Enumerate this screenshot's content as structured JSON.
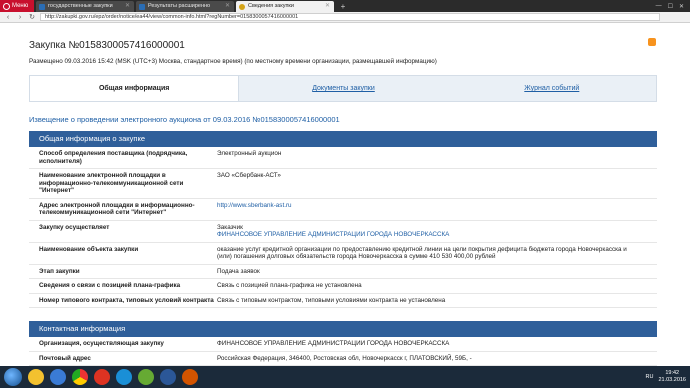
{
  "browser": {
    "menu_label": "Меню",
    "tabs": [
      {
        "label": "государственные закупки",
        "active": false
      },
      {
        "label": "Результаты расширенно",
        "active": false
      },
      {
        "label": "Сведения закупки",
        "active": true
      }
    ],
    "url": "http://zakupki.gov.ru/epz/order/notice/ea44/view/common-info.html?regNumber=0158300057416000001"
  },
  "page": {
    "title": "Закупка №0158300057416000001",
    "posted": "Размещено 09.03.2016 15:42 (MSK (UTC+3) Москва, стандартное время) (по местному времени организации, размещавшей информацию)",
    "tabs": [
      "Общая информация",
      "Документы закупки",
      "Журнал событий"
    ],
    "notice_title": "Извещение о проведении электронного аукциона от 09.03.2016 №0158300057416000001",
    "section_general": "Общая информация о закупке",
    "rows": [
      {
        "k": "Способ определения поставщика (подрядчика, исполнителя)",
        "v": "Электронный аукцион"
      },
      {
        "k": "Наименование электронной площадки в информационно-телекоммуникационной сети \"Интернет\"",
        "v": "ЗАО «Сбербанк-АСТ»"
      },
      {
        "k": "Адрес электронной площадки в информационно-телекоммуникационной сети \"Интернет\"",
        "v": "http://www.sberbank-ast.ru",
        "link": true
      },
      {
        "k": "Закупку осуществляет",
        "v": "Заказчик",
        "v2": "ФИНАНСОВОЕ УПРАВЛЕНИЕ АДМИНИСТРАЦИИ ГОРОДА НОВОЧЕРКАССКА"
      },
      {
        "k": "Наименование объекта закупки",
        "v": "оказание услуг кредитной организации по предоставлению кредитной линии на цели покрытия дефицита бюджета города Новочеркасска и (или) погашения долговых обязательств города Новочеркасска в сумме 410 530 400,00 рублей"
      },
      {
        "k": "Этап закупки",
        "v": "Подача заявок"
      },
      {
        "k": "Сведения о связи с позицией плана-графика",
        "v": "Связь с позицией плана-графика не установлена"
      },
      {
        "k": "Номер типового контракта, типовых условий контракта",
        "v": "Связь с типовым контрактом, типовыми условиями контракта не установлена"
      }
    ],
    "section_contact": "Контактная информация",
    "contact_rows": [
      {
        "k": "Организация, осуществляющая закупку",
        "v": "ФИНАНСОВОЕ УПРАВЛЕНИЕ АДМИНИСТРАЦИИ ГОРОДА НОВОЧЕРКАССКА"
      },
      {
        "k": "Почтовый адрес",
        "v": "Российская Федерация, 346400, Ростовская обл, Новочеркасск г, ПЛАТОВСКИЙ, 59Б, -"
      }
    ]
  },
  "taskbar": {
    "lang": "RU",
    "time": "19:42",
    "date": "21.03.2016"
  }
}
